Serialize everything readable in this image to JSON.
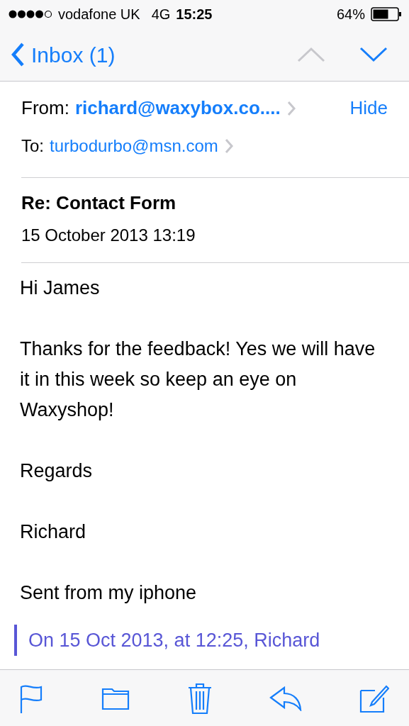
{
  "status_bar": {
    "carrier": "vodafone UK",
    "network": "4G",
    "time": "15:25",
    "battery": "64%"
  },
  "nav": {
    "back": "Inbox (1)",
    "previous": {
      "disabled": true
    },
    "next": {
      "disabled": false
    }
  },
  "header": {
    "from_label": "From:",
    "from": "richard@waxybox.co....",
    "hide": "Hide",
    "to_label": "To:",
    "to": "turbodurbo@msn.com"
  },
  "subject": "Re: Contact Form",
  "date": "15 October 2013 13:19",
  "body": [
    "Hi James",
    "Thanks for the feedback! Yes we will have it in this week so keep an eye on Waxyshop!",
    "Regards",
    "Richard",
    "Sent from my iphone"
  ],
  "quote": "On 15 Oct 2013, at 12:25, Richard",
  "toolbar": [
    {
      "kind": "flag"
    },
    {
      "kind": "folder"
    },
    {
      "kind": "trash"
    },
    {
      "kind": "reply"
    },
    {
      "kind": "compose"
    }
  ]
}
